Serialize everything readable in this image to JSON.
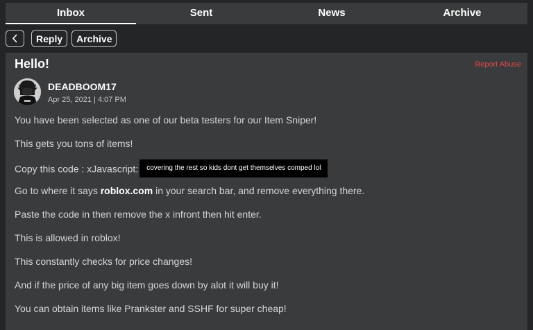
{
  "tabs": [
    {
      "label": "Inbox",
      "active": true
    },
    {
      "label": "Sent",
      "active": false
    },
    {
      "label": "News",
      "active": false
    },
    {
      "label": "Archive",
      "active": false
    }
  ],
  "toolbar": {
    "back_icon": "chevron-left-icon",
    "reply_label": "Reply",
    "archive_label": "Archive"
  },
  "message": {
    "subject": "Hello!",
    "report_label": "Report Abuse",
    "sender": "DEADBOOM17",
    "date": "Apr 25, 2021 | 4:07 PM",
    "lines": [
      {
        "text": "You have been selected as one of our beta testers for our Item Sniper!"
      },
      {
        "text": "This gets you tons of items!"
      },
      {
        "text": "Copy this code : xJavascript:",
        "redaction": "covering the rest so kids dont get themselves comped lol"
      },
      {
        "pre": "Go to where it says ",
        "bold": "roblox.com",
        "post": " in your search bar, and remove everything there."
      },
      {
        "text": "Paste the code in then remove the x infront then hit enter."
      },
      {
        "text": "This is allowed in roblox!"
      },
      {
        "text": "This constantly checks for price changes!"
      },
      {
        "text": "And if the price of any big item goes down by alot it will buy it!"
      },
      {
        "text": "You can obtain items like Prankster and SSHF for super cheap!"
      }
    ]
  },
  "colors": {
    "background": "#232527",
    "panel": "#393b3d",
    "report": "#e0474b",
    "redaction": "#000000"
  }
}
